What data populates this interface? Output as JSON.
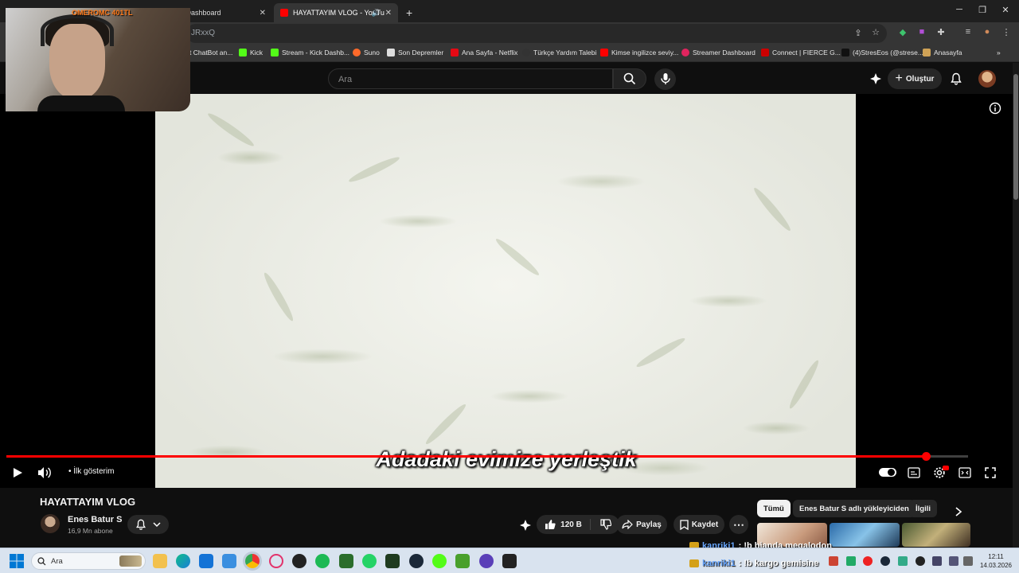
{
  "browser": {
    "tabs": [
      {
        "title": "Kick Dashboard",
        "favicon_color": "#53fc18"
      },
      {
        "title": "HAYATTAYIM VLOG - YouTu",
        "favicon_color": "#ff0000"
      }
    ],
    "url_fragment": "JRxxQ",
    "bookmarks": [
      {
        "label": "t ChatBot an...",
        "color": "#555555"
      },
      {
        "label": "Kick",
        "color": "#53fc18"
      },
      {
        "label": "Stream - Kick Dashb...",
        "color": "#53fc18"
      },
      {
        "label": "Suno",
        "color": "#ff6a2a"
      },
      {
        "label": "Son Depremler",
        "color": "#dddddd"
      },
      {
        "label": "Ana Sayfa - Netflix",
        "color": "#e50914"
      },
      {
        "label": "Türkçe Yardım Talebi",
        "color": "#333333"
      },
      {
        "label": "Kimse ingilizce seviy...",
        "color": "#ff0000"
      },
      {
        "label": "Streamer Dashboard",
        "color": "#e0245e"
      },
      {
        "label": "Connect | FIERCE G...",
        "color": "#cc0000"
      },
      {
        "label": "(4)StresEos (@strese...",
        "color": "#111111"
      },
      {
        "label": "Anasayfa",
        "color": "#cfa256"
      }
    ]
  },
  "youtube": {
    "search_placeholder": "Ara",
    "create_label": "Oluştur",
    "video": {
      "subtitle": "Adadaki evimize yerleştik",
      "chapter_label": "• İlk gösterim",
      "progress_fraction": 0.956,
      "title": "HAYATTAYIM VLOG"
    },
    "channel": {
      "name": "Enes Batur S",
      "subscribers": "16,9 Mn abone"
    },
    "actions": {
      "likes": "120 B",
      "share": "Paylaş",
      "save": "Kaydet"
    },
    "chips": [
      "Tümü",
      "Enes Batur S adlı yükleyiciden",
      "İlgili"
    ]
  },
  "overlay": {
    "donation": "OMEROMC 401TL",
    "chat": [
      {
        "user": "kanriki1",
        "message": ": !b bianda megalodon"
      },
      {
        "user": "kanriki1",
        "message": ": !b kargo gemisine"
      }
    ]
  },
  "taskbar": {
    "search_placeholder": "Ara",
    "time": "12:11",
    "date": "14.03.2026"
  }
}
